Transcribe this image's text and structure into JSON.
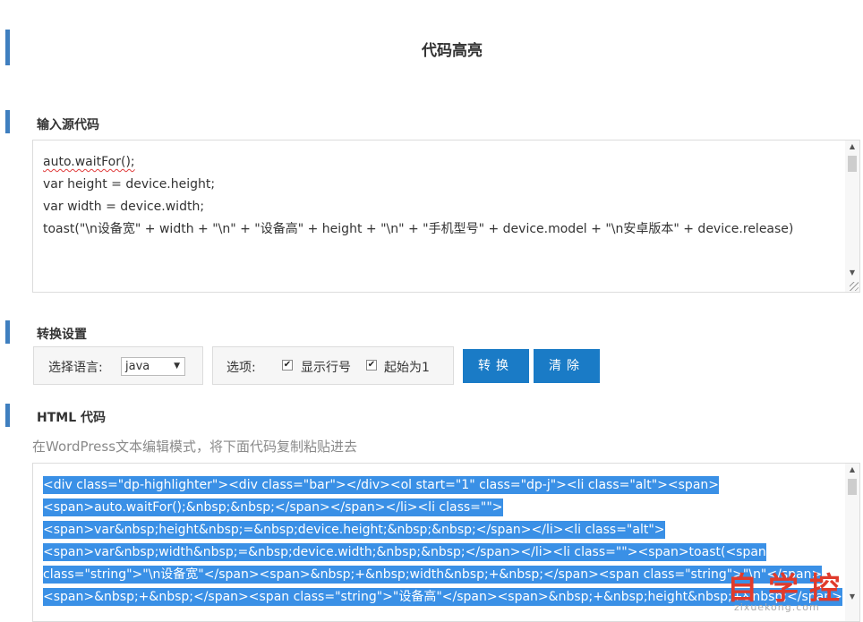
{
  "page": {
    "title": "代码高亮"
  },
  "source": {
    "label": "输入源代码",
    "lines": [
      "auto.waitFor();",
      "var height = device.height;",
      "var width = device.width;",
      "toast(\"\\n设备宽\" + width + \"\\n\" + \"设备高\" + height + \"\\n\" + \"手机型号\" + device.model + \"\\n安卓版本\" + device.release)"
    ]
  },
  "settings": {
    "label": "转换设置",
    "language_label": "选择语言:",
    "language_value": "java",
    "options_label": "选项:",
    "show_line_numbers": "显示行号",
    "show_line_numbers_checked": true,
    "start_at_one": "起始为1",
    "start_at_one_checked": true,
    "convert_button": "转换",
    "clear_button": "清除"
  },
  "output": {
    "label": "HTML 代码",
    "hint": "在WordPress文本编辑模式，将下面代码复制粘贴进去",
    "lines": [
      "<div class=\"dp-highlighter\"><div class=\"bar\"></div><ol start=\"1\" class=\"dp-j\"><li class=\"alt\"><span>",
      "<span>auto.waitFor();&nbsp;&nbsp;</span></span></li><li class=\"\">",
      "<span>var&nbsp;height&nbsp;=&nbsp;device.height;&nbsp;&nbsp;</span></li><li class=\"alt\">",
      "<span>var&nbsp;width&nbsp;=&nbsp;device.width;&nbsp;&nbsp;</span></li><li class=\"\"><span>toast(<span",
      "class=\"string\">\"\\n设备宽\"</span><span>&nbsp;+&nbsp;width&nbsp;+&nbsp;</span><span class=\"string\">\"\\n\"</span>",
      "<span>&nbsp;+&nbsp;</span><span class=\"string\">\"设备高\"</span><span>&nbsp;+&nbsp;height&nbsp;+&nbsp;</span>"
    ]
  },
  "watermark": {
    "chars": "自学控",
    "url": "zixuekong.com"
  },
  "colors": {
    "accent": "#1a7bc6",
    "bar": "#3f7fbf",
    "selection": "#3a90e6",
    "watermark": "#e03b2c"
  }
}
